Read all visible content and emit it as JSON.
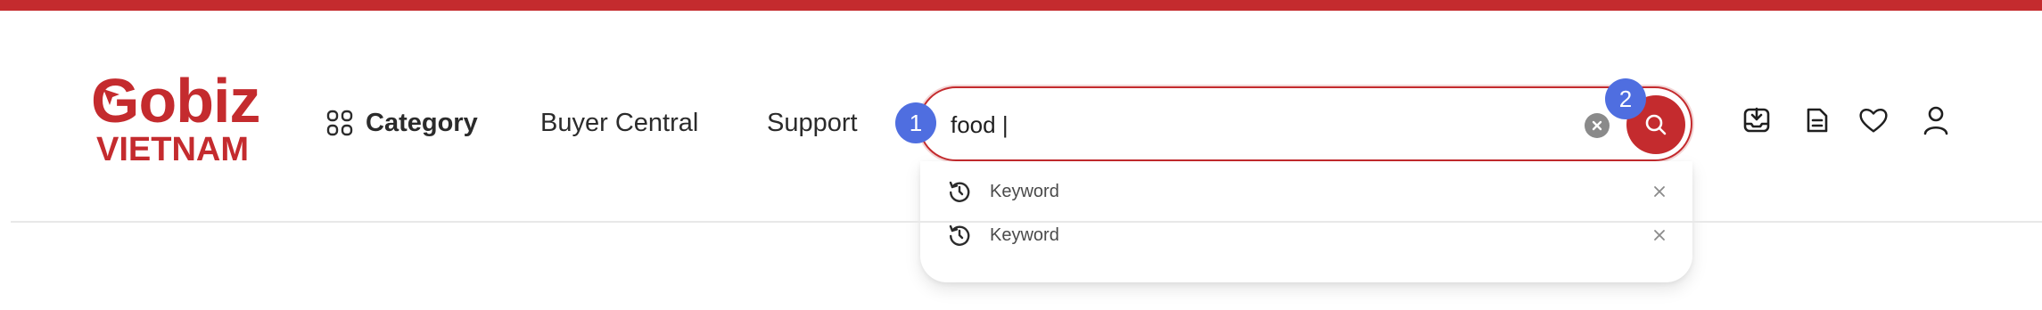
{
  "brand": {
    "logo_top": "obiz",
    "logo_top_initial": "G",
    "logo_bottom": "VIETNAM",
    "color": "#c42b2e"
  },
  "nav": {
    "category_label": "Category",
    "category_icon": "grid-icon",
    "buyer_central_label": "Buyer Central",
    "support_label": "Support"
  },
  "search": {
    "value": "food |",
    "clear_icon": "clear-icon",
    "submit_icon": "search-icon",
    "suggestions": [
      {
        "label": "Keyword",
        "icon": "history-icon",
        "remove_icon": "close-icon"
      },
      {
        "label": "Keyword",
        "icon": "history-icon",
        "remove_icon": "close-icon"
      }
    ]
  },
  "step_badges": [
    "1",
    "2"
  ],
  "header_icons": [
    "download-icon",
    "document-icon",
    "heart-icon",
    "user-icon"
  ],
  "colors": {
    "accent": "#c42b2e",
    "badge": "#4f6ee0"
  }
}
